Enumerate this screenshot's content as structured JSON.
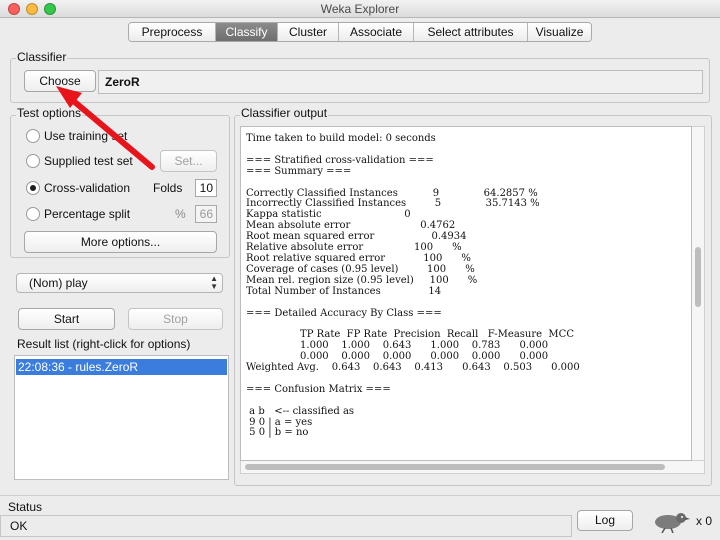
{
  "window": {
    "title": "Weka Explorer"
  },
  "tabs": [
    "Preprocess",
    "Classify",
    "Cluster",
    "Associate",
    "Select attributes",
    "Visualize"
  ],
  "classifier": {
    "group_label": "Classifier",
    "choose_label": "Choose",
    "value": "ZeroR"
  },
  "test_options": {
    "group_label": "Test options",
    "use_training_set": "Use training set",
    "supplied_test_set": "Supplied test set",
    "set_button": "Set...",
    "cross_validation": "Cross-validation",
    "folds_label": "Folds",
    "folds_value": "10",
    "percentage_split": "Percentage split",
    "percent_symbol": "%",
    "percent_value": "66",
    "more_options": "More options...",
    "selected": "cross_validation"
  },
  "class_select": {
    "value": "(Nom) play"
  },
  "actions": {
    "start": "Start",
    "stop": "Stop"
  },
  "result_list": {
    "group_label": "Result list (right-click for options)",
    "items": [
      "22:08:36 - rules.ZeroR"
    ]
  },
  "output": {
    "group_label": "Classifier output",
    "lines": [
      "Time taken to build model: 0 seconds",
      "",
      "=== Stratified cross-validation ===",
      "=== Summary ===",
      "",
      "Correctly Classified Instances           9              64.2857 %",
      "Incorrectly Classified Instances         5              35.7143 %",
      "Kappa statistic                          0",
      "Mean absolute error                      0.4762",
      "Root mean squared error                  0.4934",
      "Relative absolute error                100      %",
      "Root relative squared error            100      %",
      "Coverage of cases (0.95 level)         100      %",
      "Mean rel. region size (0.95 level)     100      %",
      "Total Number of Instances               14",
      "",
      "=== Detailed Accuracy By Class ===",
      "",
      "                 TP Rate  FP Rate  Precision  Recall   F-Measure  MCC",
      "                 1.000    1.000    0.643      1.000    0.783      0.000",
      "                 0.000    0.000    0.000      0.000    0.000      0.000",
      "Weighted Avg.    0.643    0.643    0.413      0.643    0.503      0.000",
      "",
      "=== Confusion Matrix ===",
      "",
      " a b   <-- classified as",
      " 9 0 | a = yes",
      " 5 0 | b = no"
    ]
  },
  "status": {
    "label": "Status",
    "value": "OK",
    "log_button": "Log",
    "count": "x 0"
  },
  "colors": {
    "annotation_arrow": "#e8141c",
    "selection": "#3b7ddd",
    "active_tab": "#7a7a7a"
  }
}
